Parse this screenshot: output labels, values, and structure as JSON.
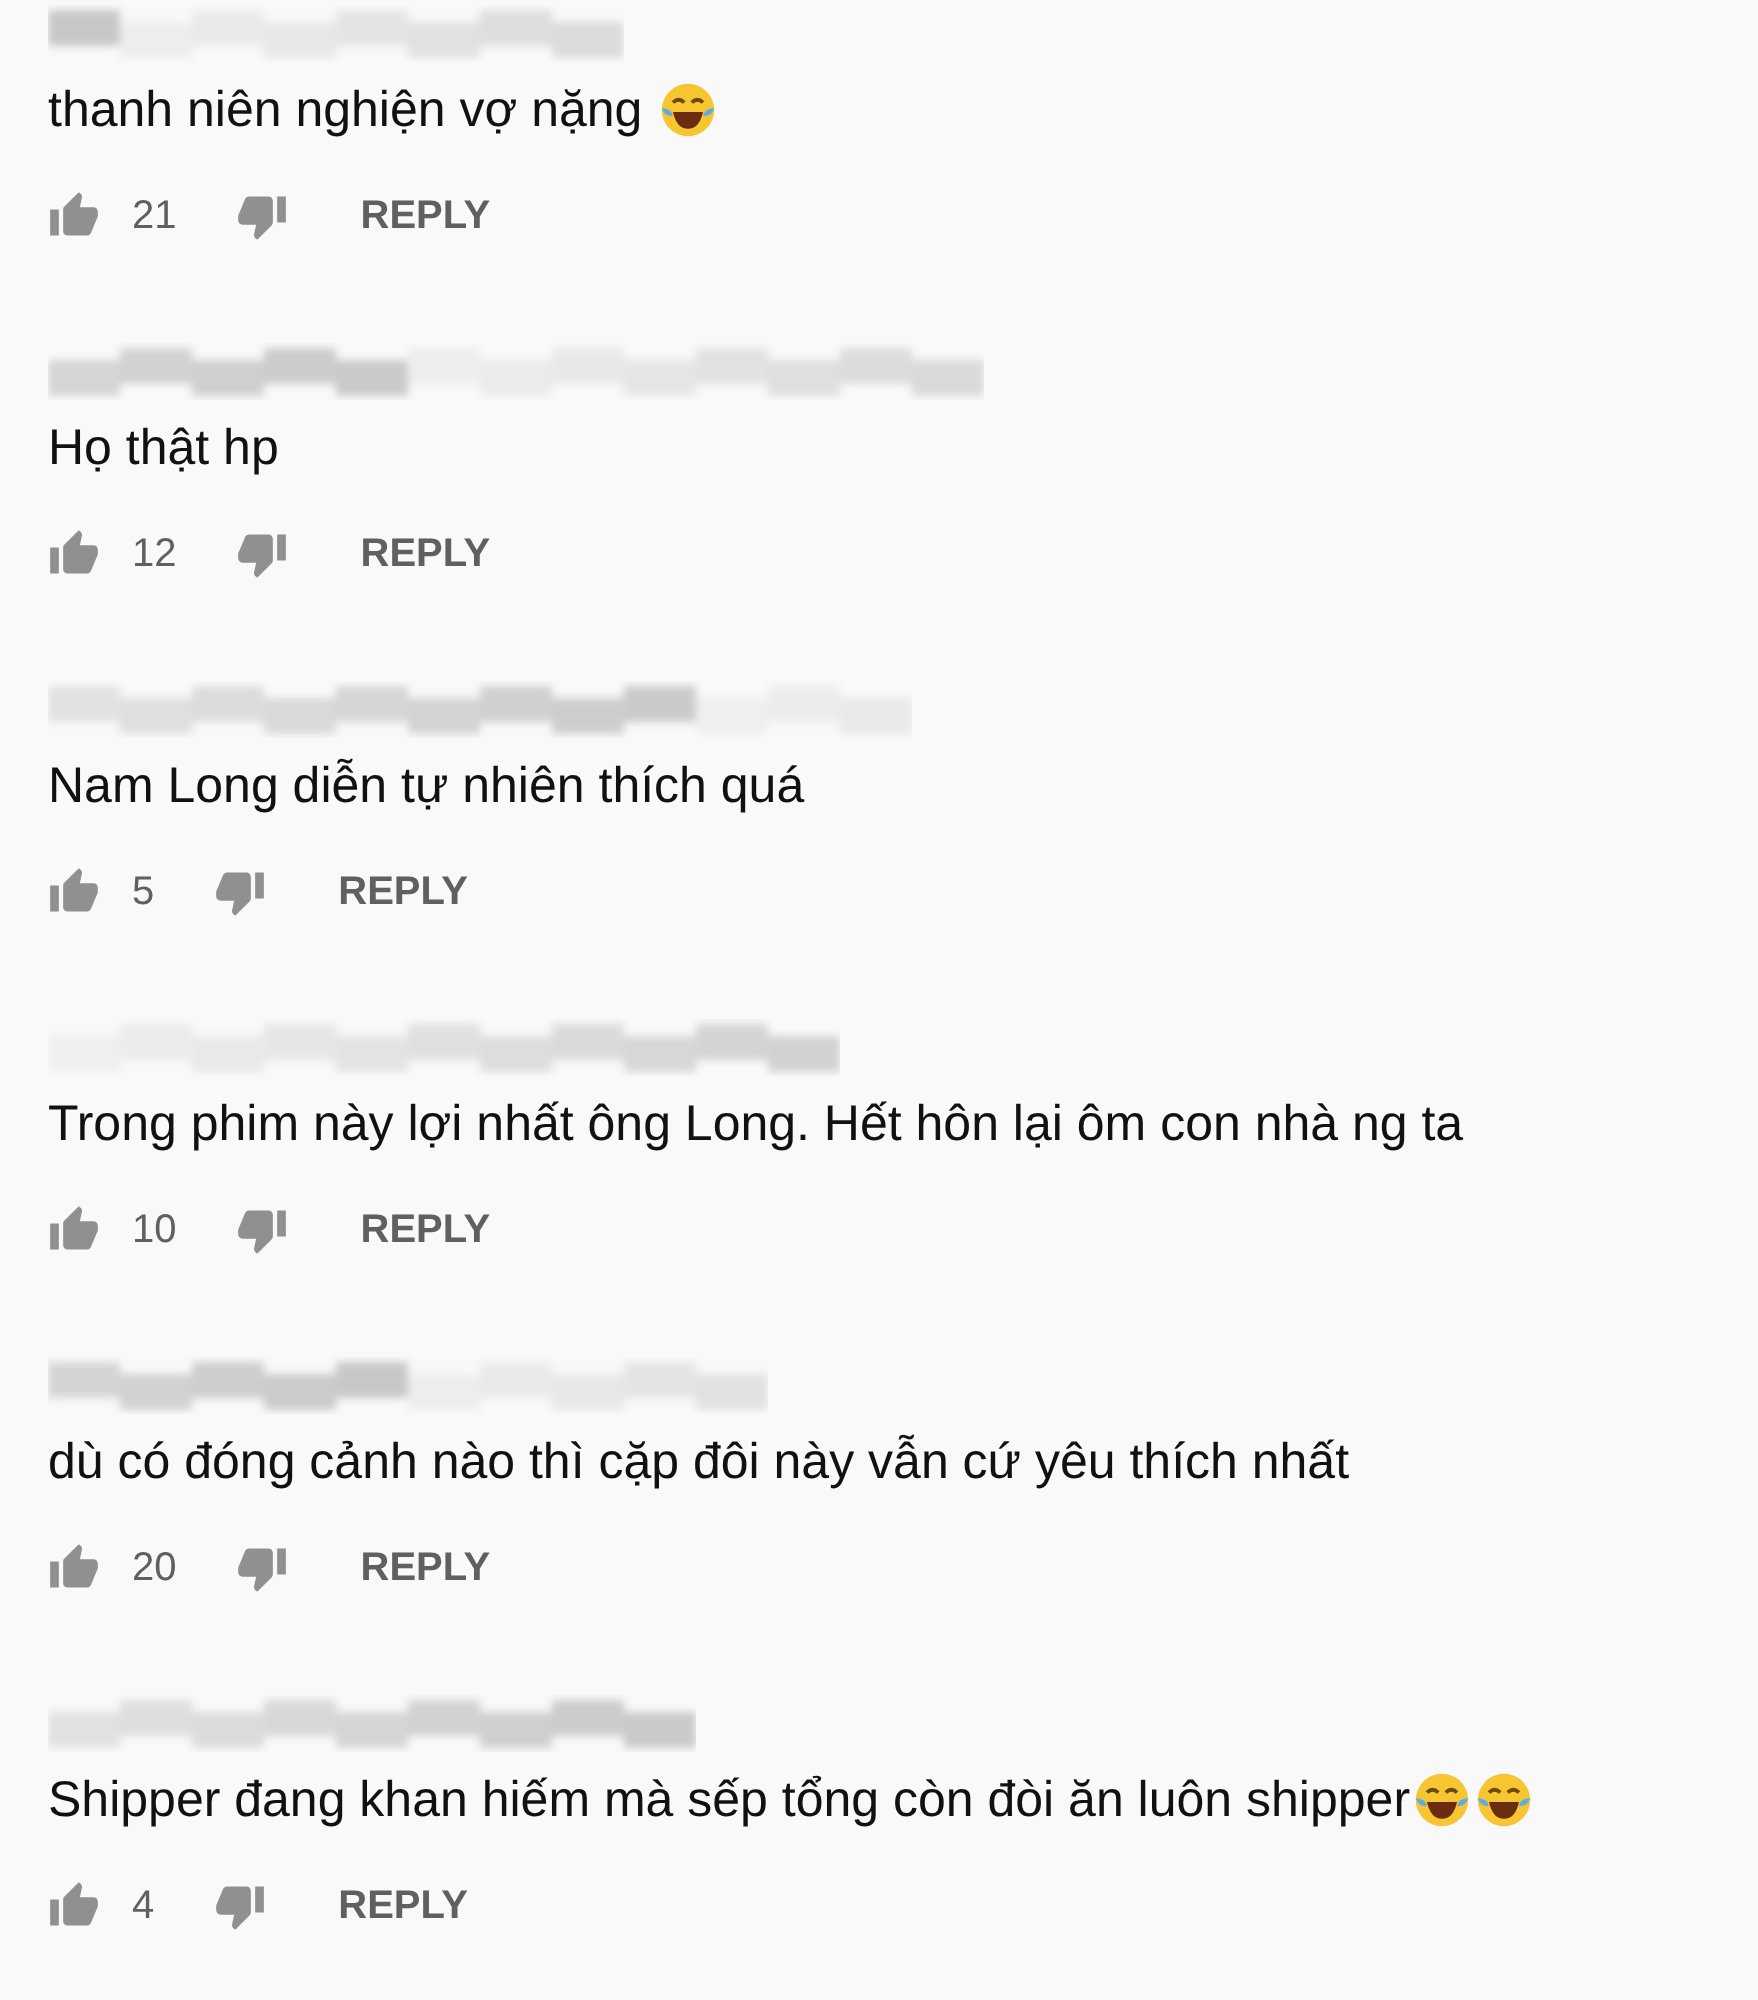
{
  "comments": [
    {
      "text": "thanh niên nghiện vợ nặng ",
      "emojis": [
        {
          "kind": "tears-of-joy"
        }
      ],
      "likes": "21",
      "reply": "REPLY"
    },
    {
      "text": "Họ thật hp",
      "likes": "12",
      "reply": "REPLY"
    },
    {
      "text": "Nam Long diễn tự nhiên thích quá",
      "likes": "5",
      "reply": "REPLY"
    },
    {
      "text": "Trong phim này lợi nhất ông Long. Hết hôn lại ôm con nhà ng ta",
      "likes": "10",
      "reply": "REPLY"
    },
    {
      "text": "dù có đóng cảnh nào thì cặp đôi này vẫn cứ yêu thích nhất",
      "likes": "20",
      "reply": "REPLY"
    },
    {
      "text": "Shipper đang khan hiếm mà sếp tổng còn đòi ăn luôn shipper",
      "emojis": [
        {
          "kind": "tears-of-joy"
        },
        {
          "kind": "tears-of-joy"
        }
      ],
      "likes": "4",
      "reply": "REPLY"
    }
  ]
}
